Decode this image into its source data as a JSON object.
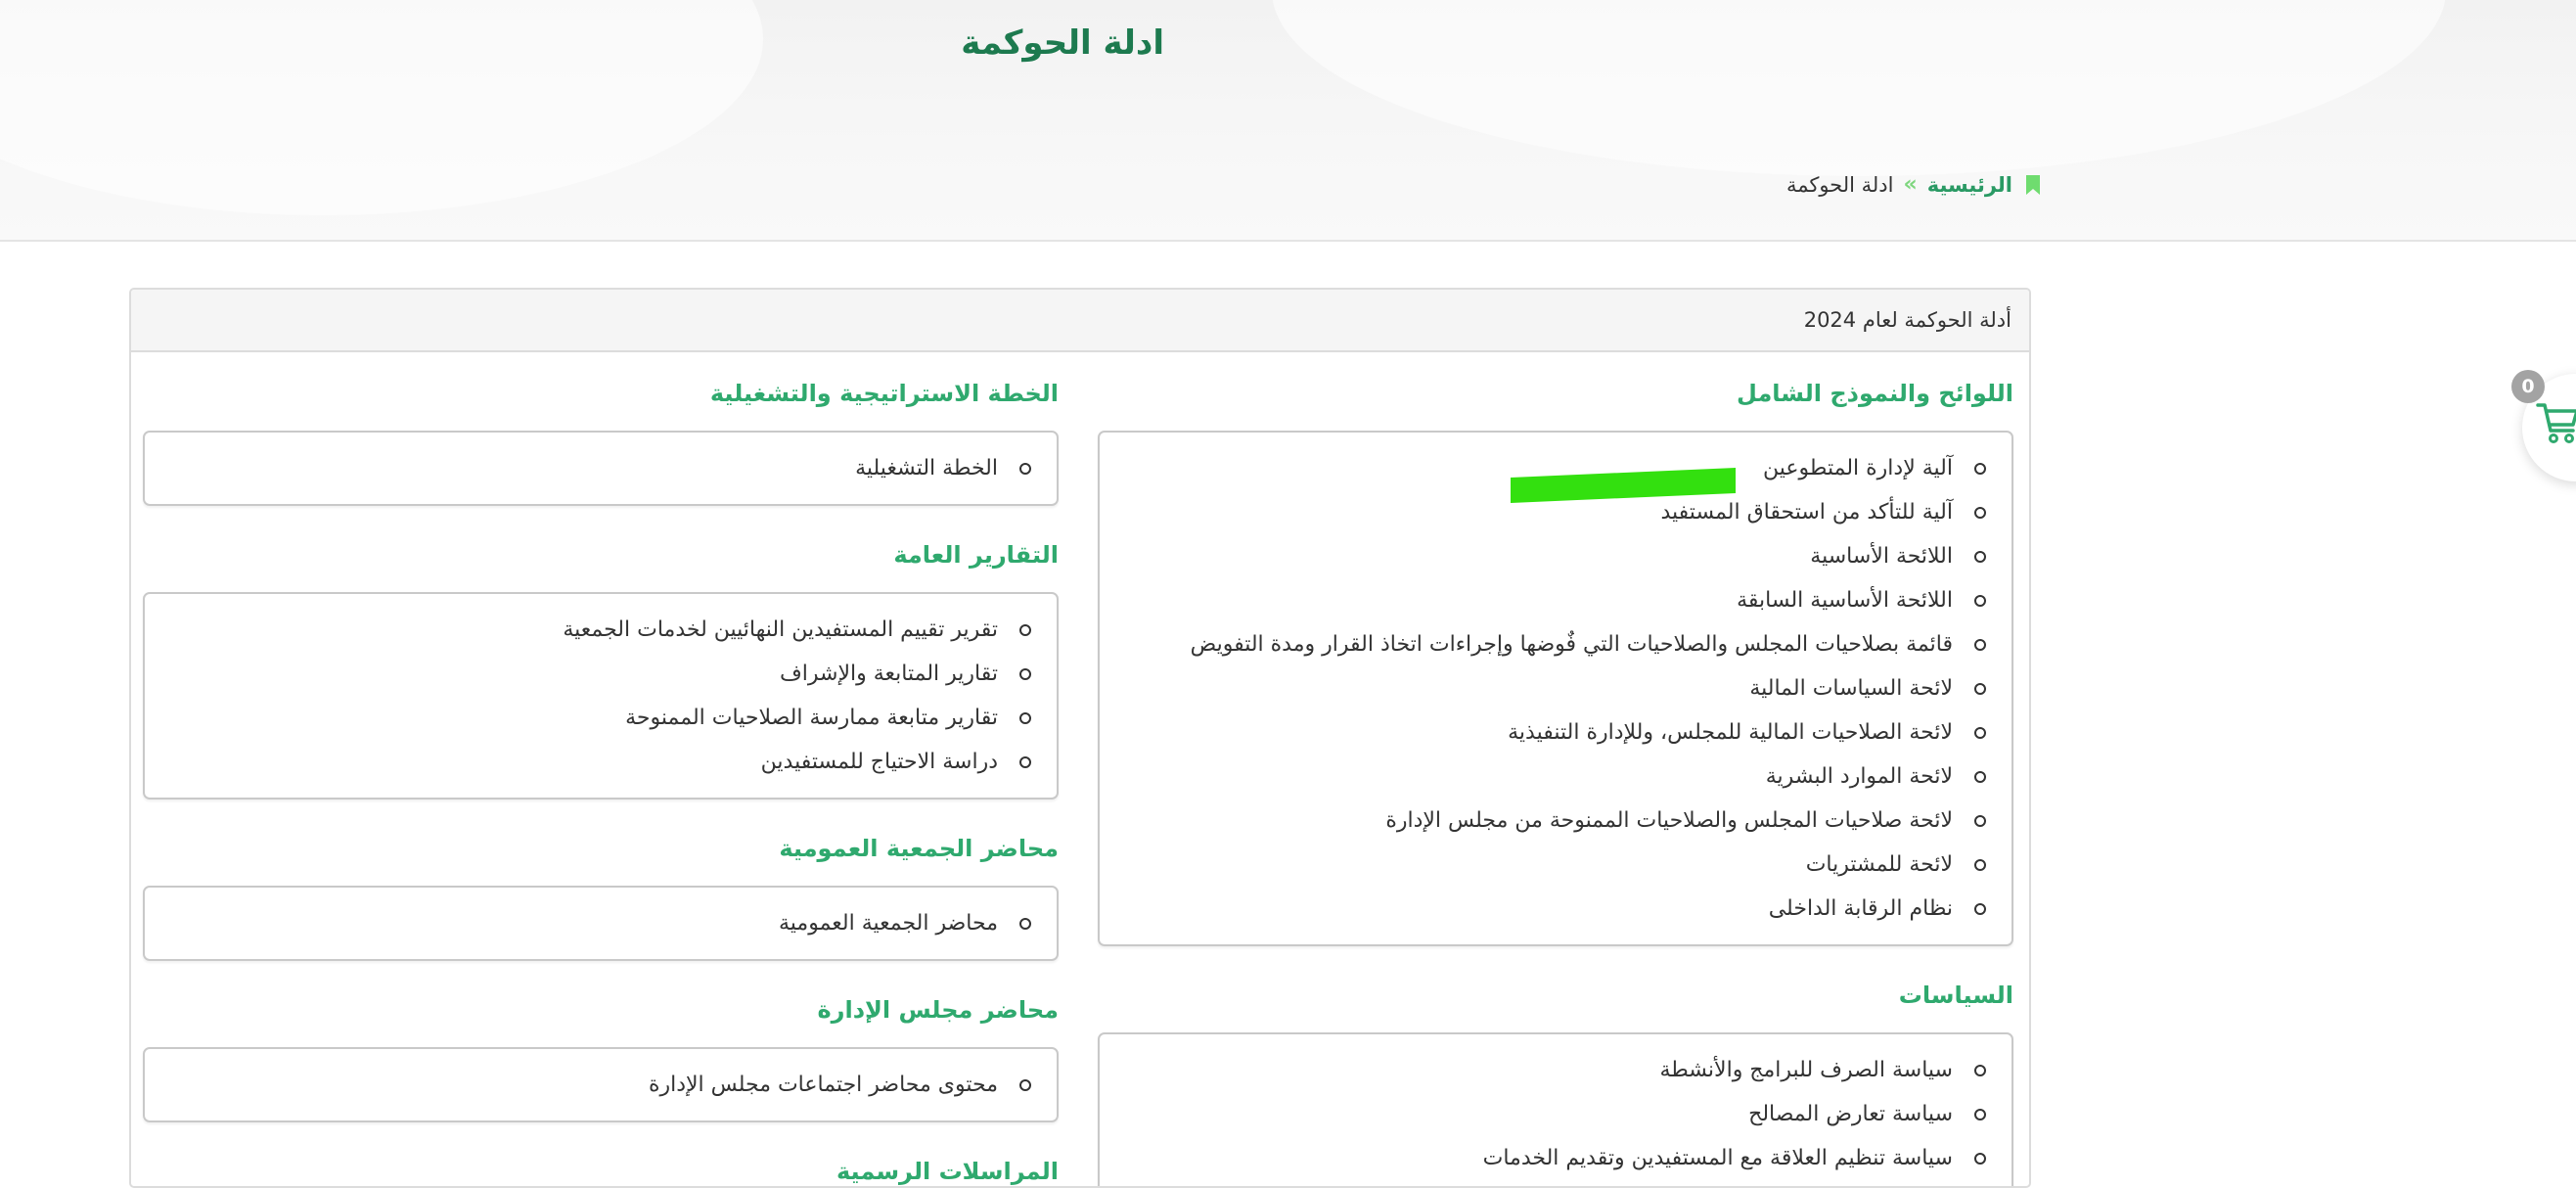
{
  "header": {
    "title": "ادلة الحوكمة"
  },
  "breadcrumb": {
    "icon": "bookmark-icon",
    "home": "الرئيسية",
    "separator": "»",
    "current": "ادلة الحوكمة"
  },
  "panel": {
    "heading": "أدلة الحوكمة لعام 2024",
    "right_column": [
      {
        "title": "اللوائح والنموذج الشامل",
        "items": [
          "آلية لإدارة المتطوعين",
          "آلية للتأكد من استحقاق المستفيد",
          "اللائحة الأساسية",
          "اللائحة الأساسية السابقة",
          "قائمة بصلاحيات المجلس والصلاحيات التي فٌوضها وإجراءات اتخاذ القرار ومدة التفويض",
          "لائحة السياسات المالية",
          "لائحة الصلاحيات المالية للمجلس، وللإدارة التنفيذية",
          "لائحة الموارد البشرية",
          "لائحة صلاحيات المجلس والصلاحيات الممنوحة من مجلس الإدارة",
          "لائحة للمشتريات",
          "نظام الرقابة الداخلى"
        ]
      },
      {
        "title": "السياسات",
        "items": [
          "سياسة الصرف للبرامج والأنشطة",
          "سياسة تعارض المصالح",
          "سياسة تنظيم العلاقة مع المستفيدين وتقديم الخدمات"
        ]
      }
    ],
    "left_column": [
      {
        "title": "الخطة الاستراتيجية والتشغيلية",
        "items": [
          "الخطة التشغيلية"
        ]
      },
      {
        "title": "التقارير العامة",
        "items": [
          "تقرير تقييم المستفيدين النهائيين لخدمات الجمعية",
          "تقارير المتابعة والإشراف",
          "تقارير متابعة ممارسة الصلاحيات الممنوحة",
          "دراسة الاحتياج للمستفيدين"
        ]
      },
      {
        "title": "محاضر الجمعية العمومية",
        "items": [
          "محاضر الجمعية العمومية"
        ]
      },
      {
        "title": "محاضر مجلس الإدارة",
        "items": [
          "محتوى محاضر اجتماعات مجلس الإدارة"
        ]
      },
      {
        "title": "المراسلات الرسمية",
        "items": []
      }
    ]
  },
  "cart": {
    "icon": "shopping-cart-icon",
    "count": "0"
  },
  "colors": {
    "title_green": "#1d7a4f",
    "section_green": "#2fa96e",
    "breadcrumb_green": "#2a9a64",
    "highlight_green": "#33e00f"
  }
}
